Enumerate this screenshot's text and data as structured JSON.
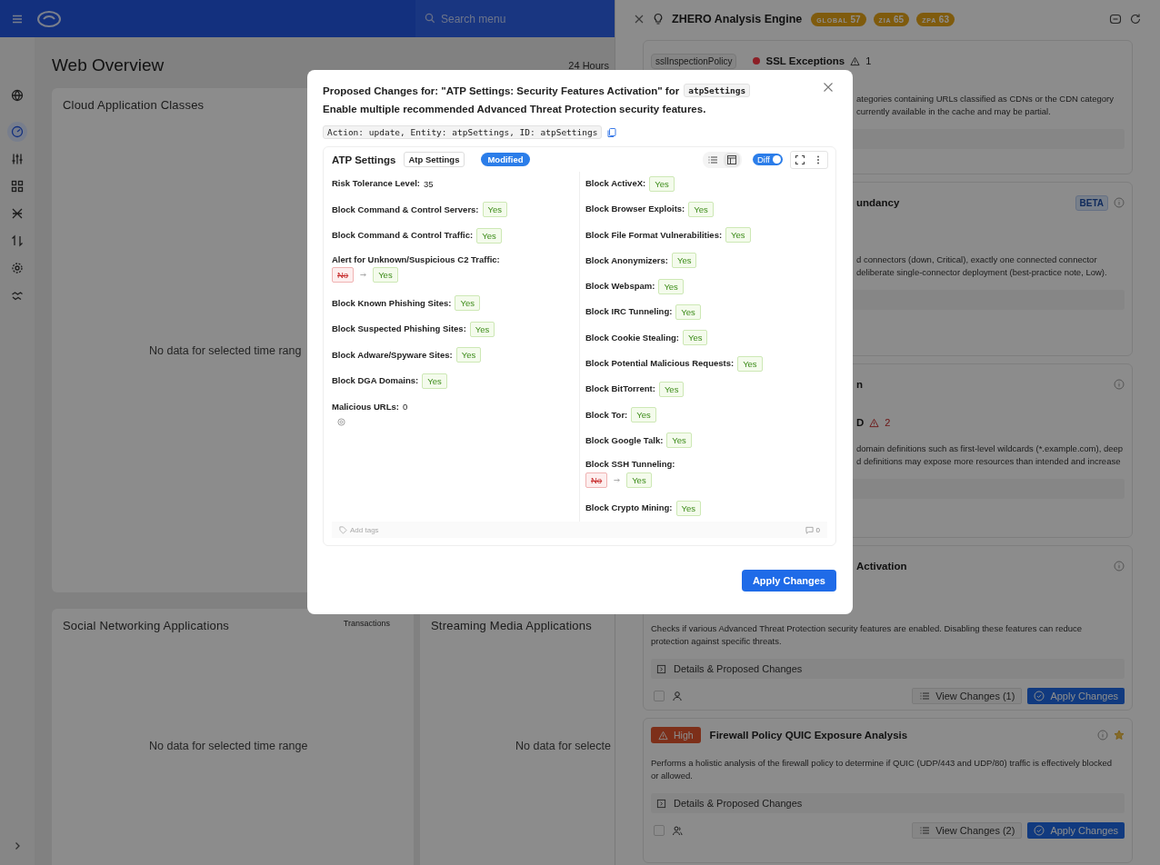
{
  "topbar": {
    "search": {
      "placeholder": "Search menu"
    }
  },
  "sidebar": {
    "items": [
      {
        "selected": false
      },
      {
        "selected": true
      },
      {
        "selected": false
      },
      {
        "selected": false
      },
      {
        "selected": false
      },
      {
        "selected": false
      },
      {
        "selected": false
      },
      {
        "selected": false
      }
    ]
  },
  "page": {
    "title": "Web Overview",
    "time_range": "24 Hours",
    "cards": [
      {
        "title": "Cloud Application Classes",
        "empty_text": "No data for selected time rang"
      },
      {
        "title": "Social Networking Applications",
        "note": "Transactions",
        "empty_text": "No data for selected time range"
      },
      {
        "title": "Streaming Media Applications",
        "empty_text": "No data for selecte"
      }
    ]
  },
  "drawer": {
    "title": "ZHERO Analysis Engine",
    "scores": [
      {
        "label": "GLOBAL",
        "value": "57"
      },
      {
        "label": "ZIA",
        "value": "65"
      },
      {
        "label": "ZPA",
        "value": "63"
      }
    ],
    "findings": [
      {
        "kind": "tagged",
        "tag": "sslInspectionPolicy",
        "color": "#8c1f26",
        "title": "SSL Exceptions",
        "warnings": "1",
        "desc": [
          {
            "text": "ategories containing URLs classified as CDNs or the CDN category",
            "covered": true
          },
          {
            "text": "currently available in the cache and may be partial.",
            "covered": true
          }
        ]
      },
      {
        "kind": "titled",
        "title": "undancy",
        "title_covered": true,
        "badge": "BETA",
        "desc": [
          {
            "text": "d connectors (down, Critical), exactly one connected connector",
            "covered": true
          },
          {
            "text": "deliberate single-connector deployment (best-practice note, Low).",
            "covered": true
          }
        ]
      },
      {
        "kind": "titled",
        "title": "n",
        "title_covered": true,
        "code": "D",
        "warnings": "2",
        "desc": [
          {
            "text": "domain definitions such as first-level wildcards (*.example.com), deep",
            "covered": true
          },
          {
            "text": "d definitions may expose more resources than intended and increase",
            "covered": true
          }
        ]
      },
      {
        "kind": "titled",
        "title": "Activation",
        "title_covered": true,
        "description": "Checks if various Advanced Threat Protection security features are enabled. Disabling these features can reduce protection against specific threats.",
        "details": "Details & Proposed Changes",
        "footer": {
          "checked": false,
          "kind": "user",
          "view": "View Changes (1)",
          "apply": "Apply Changes"
        }
      },
      {
        "kind": "titled",
        "title": "Firewall Policy QUIC Exposure Analysis",
        "title_covered": false,
        "severity": "High",
        "starred": true,
        "description": "Performs a holistic analysis of the firewall policy to determine if QUIC (UDP/443 and UDP/80) traffic is effectively blocked or allowed.",
        "details": "Details & Proposed Changes",
        "footer": {
          "checked": false,
          "kind": "users",
          "view": "View Changes (2)",
          "apply": "Apply Changes"
        }
      }
    ]
  },
  "modal": {
    "title": "Proposed Changes for: \"ATP Settings: Security Features Activation\" for",
    "title_code": "atpSettings",
    "subtitle": "Enable multiple recommended Advanced Threat Protection security features.",
    "action": "Action: update, Entity: atpSettings, ID: atpSettings",
    "entity": {
      "title": "ATP Settings",
      "type": "Atp Settings",
      "status": "Modified",
      "view_modes": [
        {
          "selected": false
        },
        {
          "selected": true
        }
      ],
      "diff": {
        "label": "Diff",
        "on": true
      },
      "columns": [
        [
          {
            "kind": "plain",
            "label": "Risk Tolerance Level:",
            "value": "35"
          },
          {
            "kind": "tag",
            "label": "Block Command & Control Servers:",
            "value": "Yes"
          },
          {
            "kind": "tag",
            "label": "Block Command & Control Traffic:",
            "value": "Yes"
          },
          {
            "kind": "change",
            "label": "Alert for Unknown/Suspicious C2 Traffic:",
            "old": "No",
            "value": "Yes"
          },
          {
            "kind": "tag",
            "label": "Block Known Phishing Sites:",
            "value": "Yes"
          },
          {
            "kind": "tag",
            "label": "Block Suspected Phishing Sites:",
            "value": "Yes"
          },
          {
            "kind": "tag",
            "label": "Block Adware/Spyware Sites:",
            "value": "Yes"
          },
          {
            "kind": "tag",
            "label": "Block DGA Domains:",
            "value": "Yes"
          },
          {
            "kind": "list",
            "label": "Malicious URLs:",
            "value": "0"
          }
        ],
        [
          {
            "kind": "tag",
            "label": "Block ActiveX:",
            "value": "Yes"
          },
          {
            "kind": "tag",
            "label": "Block Browser Exploits:",
            "value": "Yes"
          },
          {
            "kind": "tag",
            "label": "Block File Format Vulnerabilities:",
            "value": "Yes"
          },
          {
            "kind": "tag",
            "label": "Block Anonymizers:",
            "value": "Yes"
          },
          {
            "kind": "tag",
            "label": "Block Webspam:",
            "value": "Yes"
          },
          {
            "kind": "tag",
            "label": "Block IRC Tunneling:",
            "value": "Yes"
          },
          {
            "kind": "tag",
            "label": "Block Cookie Stealing:",
            "value": "Yes"
          },
          {
            "kind": "tag",
            "label": "Block Potential Malicious Requests:",
            "value": "Yes"
          },
          {
            "kind": "tag",
            "label": "Block BitTorrent:",
            "value": "Yes"
          },
          {
            "kind": "tag",
            "label": "Block Tor:",
            "value": "Yes"
          },
          {
            "kind": "tag",
            "label": "Block Google Talk:",
            "value": "Yes"
          },
          {
            "kind": "change",
            "label": "Block SSH Tunneling:",
            "old": "No",
            "value": "Yes"
          },
          {
            "kind": "tag",
            "label": "Block Crypto Mining:",
            "value": "Yes"
          }
        ]
      ],
      "tags_placeholder": "Add tags",
      "comments": "0"
    },
    "apply": "Apply Changes"
  }
}
